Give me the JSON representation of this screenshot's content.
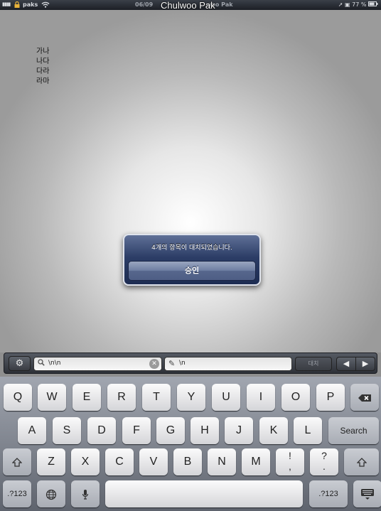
{
  "status_bar": {
    "signal": "▮▮▮▮",
    "carrier": "paks",
    "time": "06/09",
    "owner": "Chulwoo Pak",
    "owner_dim": "woo Pak",
    "battery": "77 %"
  },
  "document": {
    "lines": [
      "가나",
      "나다",
      "다라",
      "라마"
    ]
  },
  "alert": {
    "message": "4개의 항목이 대치되었습니다.",
    "button": "승인"
  },
  "find_bar": {
    "find_value": "\\n\\n",
    "replace_value": "\\n",
    "replace_button": "대치",
    "prev": "◀",
    "next": "▶"
  },
  "keyboard": {
    "row1": [
      "Q",
      "W",
      "E",
      "R",
      "T",
      "Y",
      "U",
      "I",
      "O",
      "P"
    ],
    "row2": [
      "A",
      "S",
      "D",
      "F",
      "G",
      "H",
      "J",
      "K",
      "L"
    ],
    "row3": [
      "Z",
      "X",
      "C",
      "V",
      "B",
      "N",
      "M"
    ],
    "search": "Search",
    "exclam_top": "!",
    "exclam_bottom": ",",
    "question_top": "?",
    "question_bottom": ".",
    "numbers_left": ".?123",
    "numbers_right": ".?123"
  },
  "icons": {
    "gear": "gear-icon",
    "search": "search-icon",
    "clear": "clear-icon",
    "pencil": "pencil-icon",
    "backspace": "backspace-icon",
    "shift": "shift-icon",
    "globe": "globe-icon",
    "microphone": "microphone-icon",
    "hide_keyboard": "keyboard-hide-icon"
  },
  "colors": {
    "alert_bg": "#2c3d66",
    "toolbar_bg": "#3a3d43",
    "key_bg": "#f2f2f2"
  }
}
